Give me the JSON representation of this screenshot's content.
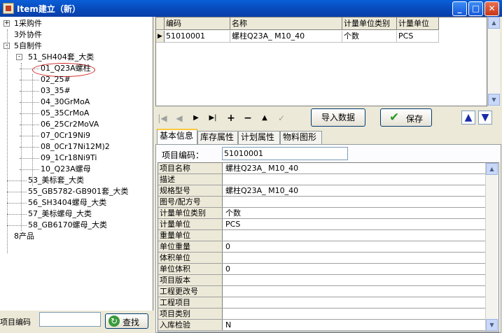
{
  "window": {
    "title": "Item建立（新）"
  },
  "tree": {
    "nodes": [
      {
        "label": "1采购件",
        "level": 0,
        "expander": "+"
      },
      {
        "label": "3外协件",
        "level": 0,
        "expander": ""
      },
      {
        "label": "5自制件",
        "level": 0,
        "expander": "-"
      },
      {
        "label": "51_SH404套_大类",
        "level": 1,
        "expander": "-"
      },
      {
        "label": "01_Q23A螺柱",
        "level": 2,
        "expander": ""
      },
      {
        "label": "02_25#",
        "level": 2,
        "expander": ""
      },
      {
        "label": "03_35#",
        "level": 2,
        "expander": ""
      },
      {
        "label": "04_30GrMoA",
        "level": 2,
        "expander": ""
      },
      {
        "label": "05_35CrMoA",
        "level": 2,
        "expander": ""
      },
      {
        "label": "06_25Cr2MoVA",
        "level": 2,
        "expander": ""
      },
      {
        "label": "07_0Cr19Ni9",
        "level": 2,
        "expander": ""
      },
      {
        "label": "08_0Cr17Ni12M)2",
        "level": 2,
        "expander": ""
      },
      {
        "label": "09_1Cr18Ni9Ti",
        "level": 2,
        "expander": ""
      },
      {
        "label": "10_Q23A螺母",
        "level": 2,
        "expander": ""
      },
      {
        "label": "53_美标套_大类",
        "level": 1,
        "expander": ""
      },
      {
        "label": "55_GB5782-GB901套_大类",
        "level": 1,
        "expander": ""
      },
      {
        "label": "56_SH3404螺母_大类",
        "level": 1,
        "expander": ""
      },
      {
        "label": "57_美标螺母_大类",
        "level": 1,
        "expander": ""
      },
      {
        "label": "58_GB6170螺母_大类",
        "level": 1,
        "expander": ""
      },
      {
        "label": "8产品",
        "level": 0,
        "expander": ""
      }
    ]
  },
  "search": {
    "label": "项目编码",
    "value": "",
    "button": "查找"
  },
  "item_grid": {
    "headers": [
      "编码",
      "名称",
      "计量单位类别",
      "计量单位"
    ],
    "rows": [
      [
        "51010001",
        "螺柱Q23A_ M10_40",
        "个数",
        "PCS"
      ]
    ]
  },
  "toolbar": {
    "nav": [
      "|◀",
      "◀",
      "▶",
      "▶|",
      "+",
      "−",
      "▲",
      "✓"
    ],
    "import_label": "导入数据",
    "save_label": "保存",
    "up_label": "▲",
    "down_label": "▼"
  },
  "tabs": [
    "基本信息",
    "库存属性",
    "计划属性",
    "物料图形"
  ],
  "basic": {
    "code_label": "项目编码：",
    "code_value": "51010001",
    "properties": [
      {
        "name": "项目名称",
        "value": "螺柱Q23A_ M10_40"
      },
      {
        "name": "描述",
        "value": ""
      },
      {
        "name": "规格型号",
        "value": "螺柱Q23A_ M10_40"
      },
      {
        "name": "图号/配方号",
        "value": ""
      },
      {
        "name": "计量单位类别",
        "value": "个数"
      },
      {
        "name": "计量单位",
        "value": "PCS"
      },
      {
        "name": "重量单位",
        "value": ""
      },
      {
        "name": "单位重量",
        "value": "0"
      },
      {
        "name": "体积单位",
        "value": ""
      },
      {
        "name": "单位体积",
        "value": "0"
      },
      {
        "name": "项目版本",
        "value": ""
      },
      {
        "name": "工程更改号",
        "value": ""
      },
      {
        "name": "工程项目",
        "value": ""
      },
      {
        "name": "项目类别",
        "value": ""
      },
      {
        "name": "入库检验",
        "value": "N"
      }
    ]
  }
}
